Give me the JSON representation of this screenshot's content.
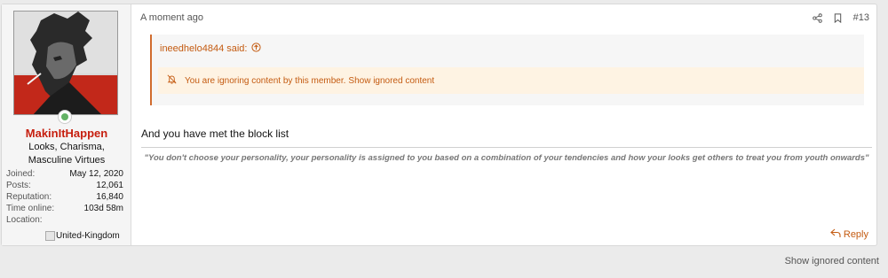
{
  "post": {
    "time": "A moment ago",
    "number": "#13",
    "message": "And you have met the block list",
    "signature": "\"You don't choose your personality, your personality is assigned to you based on a combination of your tendencies and how your looks get others to treat you from youth onwards\"",
    "reply_label": "Reply"
  },
  "user": {
    "name": "MakinItHappen",
    "title": "Looks, Charisma, Masculine Virtues",
    "stats": [
      {
        "label": "Joined:",
        "value": "May 12, 2020"
      },
      {
        "label": "Posts:",
        "value": "12,061"
      },
      {
        "label": "Reputation:",
        "value": "16,840"
      },
      {
        "label": "Time online:",
        "value": "103d 58m"
      },
      {
        "label": "Location:",
        "value": ""
      }
    ],
    "location_flag_alt": "United-Kingdom",
    "name_color": "#c61e0e"
  },
  "quote": {
    "author": "ineedhelo4844 said:",
    "ignored_text": "You are ignoring content by this member.",
    "show_ignored_link": "Show ignored content"
  },
  "footer": {
    "show_ignored": "Show ignored content"
  },
  "colors": {
    "accent": "#c45b11",
    "online": "#63b265"
  }
}
